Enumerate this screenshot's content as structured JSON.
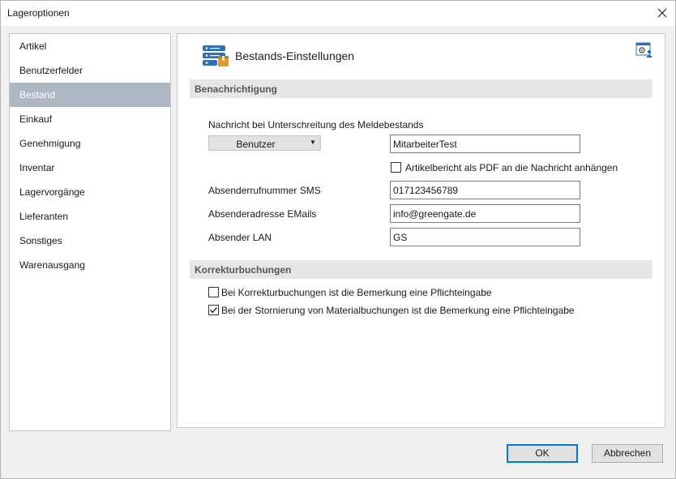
{
  "window": {
    "title": "Lageroptionen"
  },
  "sidebar": {
    "items": [
      {
        "label": "Artikel"
      },
      {
        "label": "Benutzerfelder"
      },
      {
        "label": "Bestand",
        "selected": true
      },
      {
        "label": "Einkauf"
      },
      {
        "label": "Genehmigung"
      },
      {
        "label": "Inventar"
      },
      {
        "label": "Lagervorgänge"
      },
      {
        "label": "Lieferanten"
      },
      {
        "label": "Sonstiges"
      },
      {
        "label": "Warenausgang"
      }
    ]
  },
  "content": {
    "title": "Bestands-Einstellungen",
    "sections": {
      "notification": "Benachrichtigung",
      "correction": "Korrekturbuchungen"
    },
    "notification": {
      "message_label": "Nachricht bei Unterschreitung des Meldebestands",
      "recipient_type": "Benutzer",
      "recipient_value": "MitarbeiterTest",
      "attach_pdf_label": "Artikelbericht als PDF an die Nachricht anhängen",
      "attach_pdf_checked": false,
      "sms_label": "Absenderrufnummer SMS",
      "sms_value": "017123456789",
      "email_label": "Absenderadresse EMails",
      "email_value": "info@greengate.de",
      "lan_label": "Absender LAN",
      "lan_value": "GS"
    },
    "correction": {
      "remark_required_label": "Bei Korrekturbuchungen ist die Bemerkung eine Pflichteingabe",
      "remark_required_checked": false,
      "storno_remark_label": "Bei der Stornierung von Materialbuchungen ist die Bemerkung eine Pflichteingabe",
      "storno_remark_checked": true
    }
  },
  "buttons": {
    "ok": "OK",
    "cancel": "Abbrechen"
  },
  "icons": {
    "header": "server-database-icon",
    "corner": "settings-user-icon",
    "close": "close-icon",
    "dropdown": "dropdown-arrow-icon",
    "check": "checkmark-icon"
  },
  "colors": {
    "selected_item": "#aeb8c4",
    "section_header": "#e6e6e6",
    "icon_blue": "#2f6fb5",
    "icon_orange": "#e39a2a",
    "ok_border": "#0078d7"
  }
}
